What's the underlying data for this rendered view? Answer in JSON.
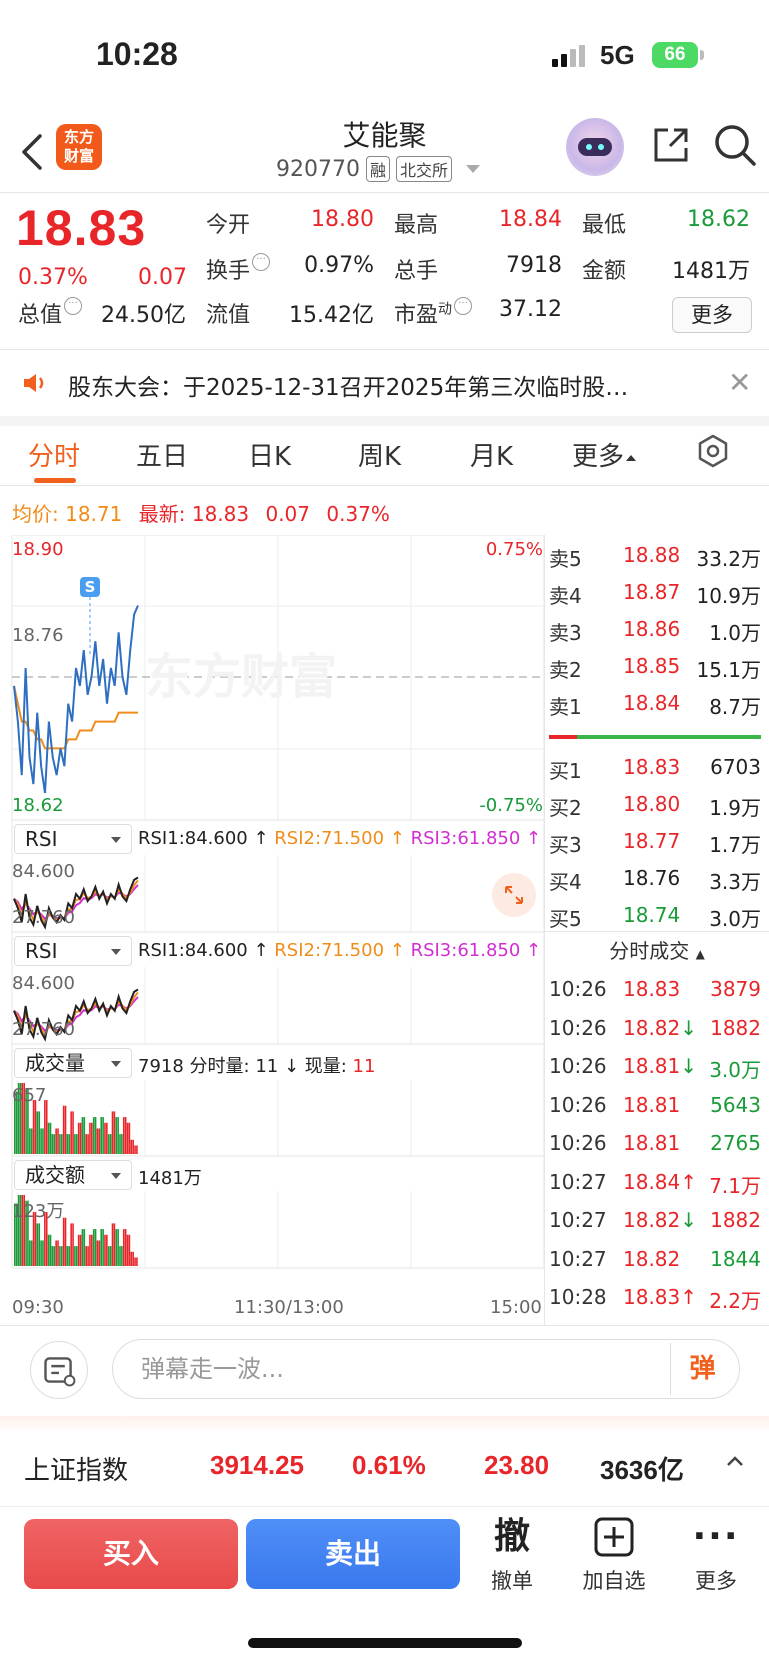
{
  "status": {
    "time": "10:28",
    "network": "5G",
    "battery": "66"
  },
  "header": {
    "logo_line1": "东方",
    "logo_line2": "财富",
    "stock_name": "艾能聚",
    "stock_code": "920770",
    "tag_margin": "融",
    "tag_exchange": "北交所"
  },
  "quote": {
    "price": "18.83",
    "change_pct": "0.37%",
    "change_val": "0.07",
    "open_label": "今开",
    "open": "18.80",
    "high_label": "最高",
    "high": "18.84",
    "low_label": "最低",
    "low": "18.62",
    "turnover_label": "换手",
    "turnover": "0.97%",
    "volume_label": "总手",
    "volume": "7918",
    "amount_label": "金额",
    "amount": "1481万",
    "mktcap_label": "总值",
    "mktcap": "24.50亿",
    "float_label": "流值",
    "float": "15.42亿",
    "pe_label": "市盈",
    "pe_sup": "动",
    "pe": "37.12",
    "more": "更多"
  },
  "notice": {
    "text": "股东大会：于2025-12-31召开2025年第三次临时股…"
  },
  "tabs": [
    "分时",
    "五日",
    "日K",
    "周K",
    "月K",
    "更多"
  ],
  "avgline": {
    "avg_label": "均价:",
    "avg": "18.71",
    "last_label": "最新:",
    "last": "18.83",
    "chg": "0.07",
    "pct": "0.37%"
  },
  "chart_data": {
    "type": "line",
    "price_axis": {
      "top": "18.90",
      "mid": "18.76",
      "bottom": "18.62",
      "top_pct": "0.75%",
      "bottom_pct": "-0.75%"
    },
    "ylim": [
      18.62,
      18.9
    ],
    "price_series": [
      18.74,
      18.7,
      18.64,
      18.76,
      18.66,
      18.63,
      18.71,
      18.65,
      18.62,
      18.7,
      18.66,
      18.64,
      18.67,
      18.65,
      18.72,
      18.7,
      18.76,
      18.74,
      18.78,
      18.73,
      18.75,
      18.79,
      18.74,
      18.77,
      18.72,
      18.76,
      18.74,
      18.8,
      18.75,
      18.73,
      18.78,
      18.82,
      18.83
    ],
    "avg_series": [
      18.74,
      18.72,
      18.7,
      18.7,
      18.69,
      18.69,
      18.68,
      18.68,
      18.67,
      18.67,
      18.67,
      18.67,
      18.67,
      18.67,
      18.68,
      18.68,
      18.68,
      18.69,
      18.69,
      18.69,
      18.69,
      18.7,
      18.7,
      18.7,
      18.7,
      18.7,
      18.7,
      18.71,
      18.71,
      18.71,
      18.71,
      18.71,
      18.71
    ],
    "marker": "S",
    "time_labels": [
      "09:30",
      "11:30/13:00",
      "15:00"
    ]
  },
  "indicators": {
    "rsi_name": "RSI",
    "rsi1": "RSI1:84.600 ↑",
    "rsi2": "RSI2:71.500 ↑",
    "rsi3": "RSI3:61.850 ↑",
    "rsi_top": "84.600",
    "rsi_bottom": "27.760",
    "vol_name": "成交量",
    "vol_info": "7918 分时量: 11 ↓ 现量: ",
    "vol_now": "11",
    "vol_max": "657",
    "amt_name": "成交额",
    "amt_info": "1481万",
    "amt_max": "123万"
  },
  "orderbook": {
    "asks": [
      {
        "label": "卖5",
        "price": "18.88",
        "vol": "33.2万"
      },
      {
        "label": "卖4",
        "price": "18.87",
        "vol": "10.9万"
      },
      {
        "label": "卖3",
        "price": "18.86",
        "vol": "1.0万"
      },
      {
        "label": "卖2",
        "price": "18.85",
        "vol": "15.1万"
      },
      {
        "label": "卖1",
        "price": "18.84",
        "vol": "8.7万"
      }
    ],
    "bids": [
      {
        "label": "买1",
        "price": "18.83",
        "vol": "6703"
      },
      {
        "label": "买2",
        "price": "18.80",
        "vol": "1.9万"
      },
      {
        "label": "买3",
        "price": "18.77",
        "vol": "1.7万"
      },
      {
        "label": "买4",
        "price": "18.76",
        "vol": "3.3万"
      },
      {
        "label": "买5",
        "price": "18.74",
        "vol": "3.0万"
      }
    ],
    "ticks_title": "分时成交",
    "ticks": [
      {
        "time": "10:26",
        "price": "18.83",
        "arrow": "",
        "vol": "3879"
      },
      {
        "time": "10:26",
        "price": "18.82",
        "arrow": "↓",
        "vol": "1882"
      },
      {
        "time": "10:26",
        "price": "18.81",
        "arrow": "↓",
        "vol": "3.0万"
      },
      {
        "time": "10:26",
        "price": "18.81",
        "arrow": "",
        "vol": "5643"
      },
      {
        "time": "10:26",
        "price": "18.81",
        "arrow": "",
        "vol": "2765"
      },
      {
        "time": "10:27",
        "price": "18.84",
        "arrow": "↑",
        "vol": "7.1万"
      },
      {
        "time": "10:27",
        "price": "18.82",
        "arrow": "↓",
        "vol": "1882"
      },
      {
        "time": "10:27",
        "price": "18.82",
        "arrow": "",
        "vol": "1844"
      },
      {
        "time": "10:28",
        "price": "18.83",
        "arrow": "↑",
        "vol": "2.2万"
      }
    ]
  },
  "comment": {
    "placeholder": "弹幕走一波...",
    "danmu": "弹"
  },
  "index": {
    "name": "上证指数",
    "value": "3914.25",
    "pct": "0.61%",
    "chg": "23.80",
    "amount": "3636亿"
  },
  "actions": {
    "buy": "买入",
    "sell": "卖出",
    "cancel_big": "撤",
    "cancel": "撤单",
    "add": "加自选",
    "more": "更多"
  },
  "colors": {
    "up": "#e8262a",
    "down": "#1a9b3a",
    "accent": "#f2601e",
    "price_line": "#2f6fc2",
    "avg_line": "#f08c1a"
  }
}
